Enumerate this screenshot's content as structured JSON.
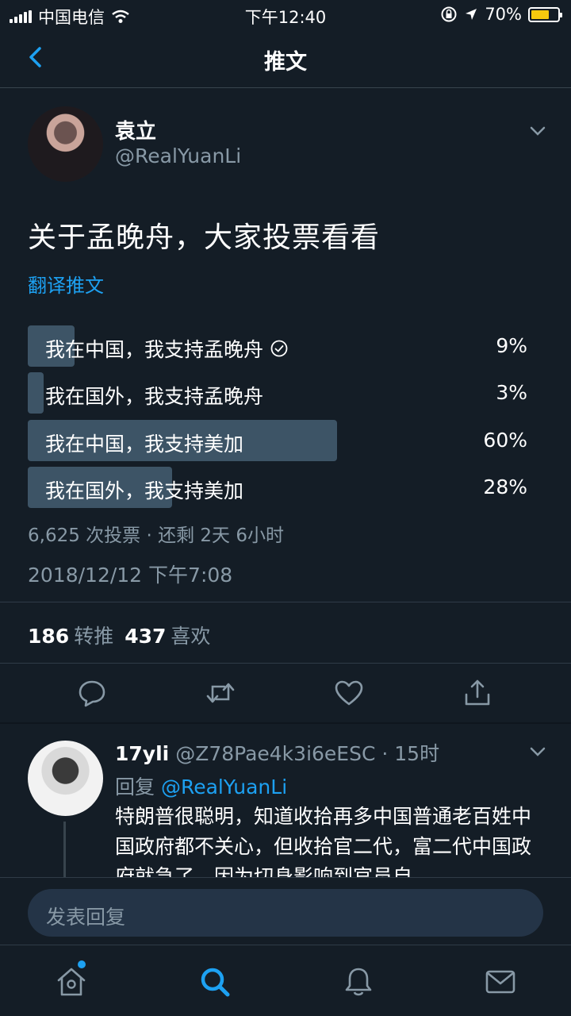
{
  "status_bar": {
    "carrier": "中国电信",
    "time": "下午12:40",
    "battery_pct": "70%",
    "battery_level": 0.7
  },
  "nav": {
    "title": "推文"
  },
  "tweet": {
    "author_name": "袁立",
    "author_handle": "@RealYuanLi",
    "text": "关于孟晚舟，大家投票看看",
    "translate_label": "翻译推文",
    "poll": {
      "options": [
        {
          "label": "我在中国，我支持孟晚舟",
          "percent": "9%",
          "share": 0.09,
          "voted": true
        },
        {
          "label": "我在国外，我支持孟晚舟",
          "percent": "3%",
          "share": 0.03,
          "voted": false
        },
        {
          "label": "我在中国，我支持美加",
          "percent": "60%",
          "share": 0.6,
          "voted": false
        },
        {
          "label": "我在国外，我支持美加",
          "percent": "28%",
          "share": 0.28,
          "voted": false
        }
      ],
      "meta": "6,625 次投票 · 还剩 2天 6小时"
    },
    "timestamp": "2018/12/12 下午7:08",
    "retweet_count": "186",
    "retweet_label": "转推",
    "like_count": "437",
    "like_label": "喜欢"
  },
  "reply": {
    "name": "17yli",
    "handle_time": "@Z78Pae4k3i6eESC · 15时",
    "reply_prefix": "回复",
    "reply_to": "@RealYuanLi",
    "text": "特朗普很聪明，知道收拾再多中国普通老百姓中国政府都不关心，但收拾官二代，富二代中国政府就急了，因为切身影响到官员自"
  },
  "compose": {
    "placeholder": "发表回复"
  },
  "colors": {
    "background": "#141d26",
    "accent": "#1da1f2",
    "poll_bar": "#3d5466",
    "secondary_text": "#8899a6"
  }
}
